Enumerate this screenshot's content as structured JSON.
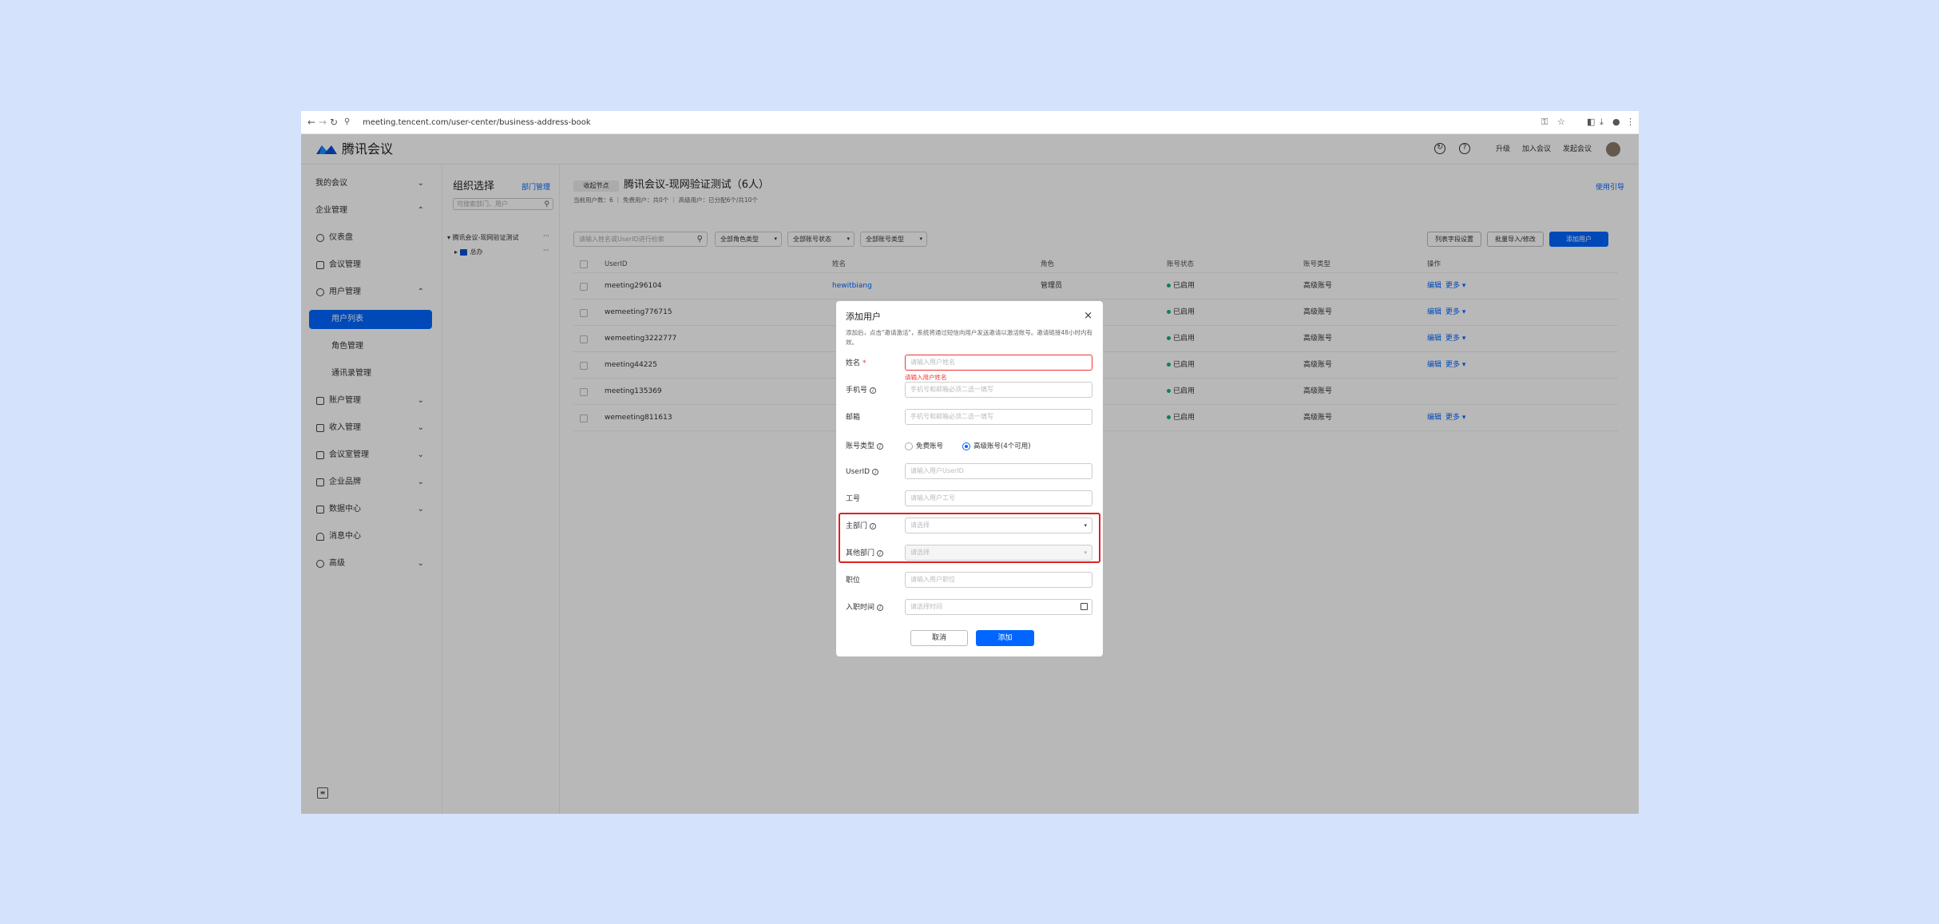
{
  "browser": {
    "url": "meeting.tencent.com/user-center/business-address-book"
  },
  "header": {
    "brand": "腾讯会议",
    "links": [
      "升级",
      "加入会议",
      "发起会议"
    ]
  },
  "sidebar": {
    "items": [
      {
        "label": "我的会议",
        "chevron": "⌄"
      },
      {
        "label": "企业管理",
        "chevron": "⌃"
      },
      {
        "label": "仪表盘"
      },
      {
        "label": "会议管理"
      },
      {
        "label": "用户管理",
        "chevron": "⌃"
      },
      {
        "label": "用户列表"
      },
      {
        "label": "角色管理"
      },
      {
        "label": "通讯录管理"
      },
      {
        "label": "账户管理",
        "chevron": "⌄"
      },
      {
        "label": "收入管理",
        "chevron": "⌄"
      },
      {
        "label": "会议室管理",
        "chevron": "⌄"
      },
      {
        "label": "企业品牌",
        "chevron": "⌄"
      },
      {
        "label": "数据中心",
        "chevron": "⌄"
      },
      {
        "label": "消息中心"
      },
      {
        "label": "高级",
        "chevron": "⌄"
      }
    ]
  },
  "org": {
    "title": "组织选择",
    "manage": "部门管理",
    "search_placeholder": "可搜索部门、用户",
    "tree": [
      "腾讯会议-现网验证测试",
      "总办"
    ],
    "more": "···"
  },
  "main": {
    "back": "收起节点",
    "title": "腾讯会议-现网验证测试（6人）",
    "guide": "使用引导",
    "stats": "当前用户数：6 ｜ 免费用户：共0个 ｜ 高级用户：已分配6个/共10个",
    "search_placeholder": "请输入姓名或UserID进行检索",
    "filters": [
      "全部角色类型",
      "全部账号状态",
      "全部账号类型"
    ],
    "buttons": [
      "列表字段设置",
      "批量导入/修改",
      "添加用户"
    ],
    "columns": [
      "UserID",
      "姓名",
      "角色",
      "账号状态",
      "账号类型",
      "操作"
    ],
    "rows": [
      {
        "userid": "meeting296104",
        "name": "hewitbiang",
        "role": "管理员",
        "status": "已启用",
        "type": "高级账号",
        "edit": "编辑",
        "more": "更多 ▾"
      },
      {
        "userid": "wemeeting776715",
        "name": "",
        "role": "",
        "status": "已启用",
        "type": "高级账号",
        "edit": "编辑",
        "more": "更多 ▾"
      },
      {
        "userid": "wemeeting3222777",
        "name": "",
        "role": "",
        "status": "已启用",
        "type": "高级账号",
        "edit": "编辑",
        "more": "更多 ▾"
      },
      {
        "userid": "meeting44225",
        "name": "",
        "role": "",
        "status": "已启用",
        "type": "高级账号",
        "edit": "编辑",
        "more": "更多 ▾"
      },
      {
        "userid": "meeting135369",
        "name": "",
        "role": "",
        "status": "已启用",
        "type": "高级账号",
        "edit": "",
        "more": ""
      },
      {
        "userid": "wemeeting811613",
        "name": "",
        "role": "",
        "status": "已启用",
        "type": "高级账号",
        "edit": "编辑",
        "more": "更多 ▾"
      }
    ],
    "status_color": "#15b371"
  },
  "dialog": {
    "title": "添加用户",
    "close": "×",
    "desc": "添加后，点击\"邀请激活\"，系统将通过短信向用户发送邀请以激活账号。邀请链接48小时内有效。",
    "fields": {
      "name": {
        "label": "姓名",
        "required": "*",
        "placeholder": "请输入用户姓名",
        "error": "请输入用户姓名"
      },
      "phone": {
        "label": "手机号",
        "placeholder": "手机号和邮箱必须二选一填写"
      },
      "email": {
        "label": "邮箱",
        "placeholder": "手机号和邮箱必须二选一填写"
      },
      "account_type": {
        "label": "账号类型",
        "options": [
          "免费账号",
          "高级账号(4个可用)"
        ],
        "selected": "高级账号(4个可用)"
      },
      "userid": {
        "label": "UserID",
        "placeholder": "请输入用户UserID"
      },
      "job_no": {
        "label": "工号",
        "placeholder": "请输入用户工号"
      },
      "main_dept": {
        "label": "主部门",
        "placeholder": "请选择"
      },
      "other_dept": {
        "label": "其他部门",
        "placeholder": "请选择"
      },
      "position": {
        "label": "职位",
        "placeholder": "请输入用户职位"
      },
      "join_date": {
        "label": "入职时间",
        "placeholder": "请选择时间"
      }
    },
    "cancel": "取消",
    "add": "添加",
    "highlight_color": "#e02020"
  }
}
